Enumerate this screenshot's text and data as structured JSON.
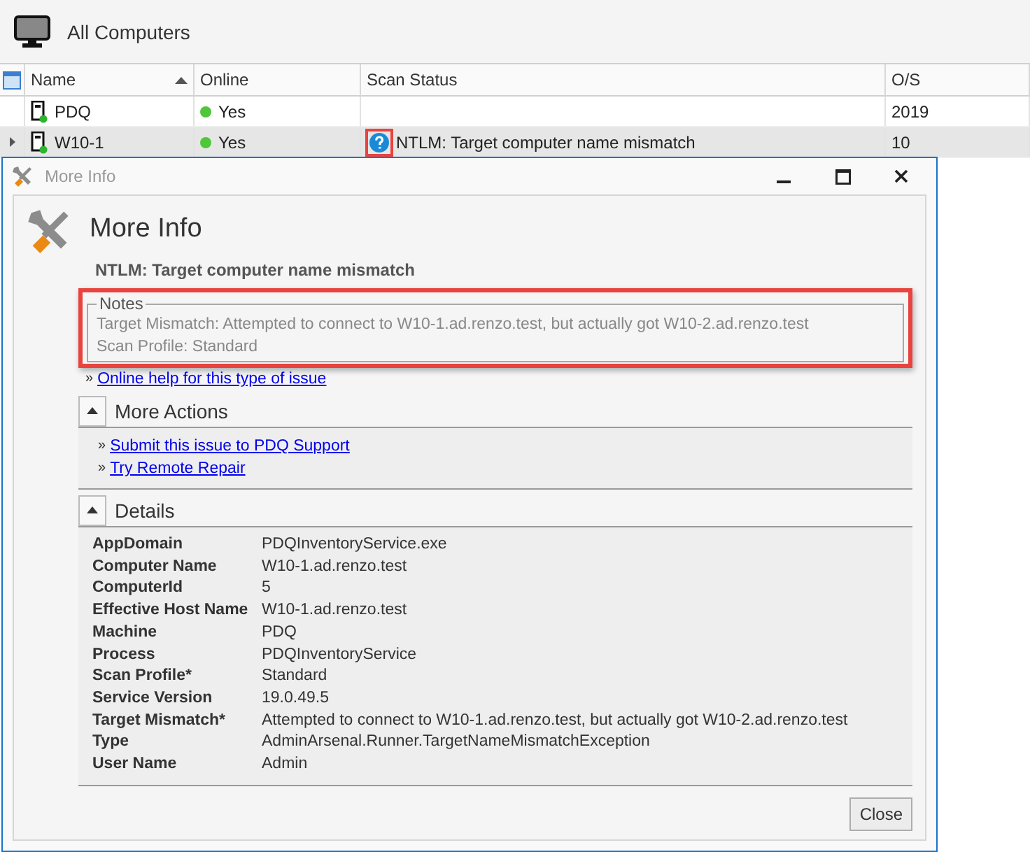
{
  "header": {
    "title": "All Computers"
  },
  "grid": {
    "columns": [
      {
        "label": "Name",
        "sorted": true
      },
      {
        "label": "Online",
        "sorted": false
      },
      {
        "label": "Scan Status",
        "sorted": false
      },
      {
        "label": "O/S",
        "sorted": false
      }
    ],
    "rows": [
      {
        "name": "PDQ",
        "online": "Yes",
        "scan_status": "",
        "os": "2019",
        "selected": false
      },
      {
        "name": "W10-1",
        "online": "Yes",
        "scan_status": "NTLM: Target computer name mismatch",
        "os": "10",
        "selected": true,
        "highlighted": true
      }
    ]
  },
  "dialog": {
    "window_title": "More Info",
    "heading": "More Info",
    "subtitle": "NTLM: Target computer name mismatch",
    "notes": {
      "legend": "Notes",
      "highlighted": true,
      "lines": [
        "Target Mismatch: Attempted to connect to W10-1.ad.renzo.test, but actually got W10-2.ad.renzo.test",
        "Scan Profile: Standard"
      ]
    },
    "help_link": {
      "bullet": "»",
      "label": "Online help for this type of issue"
    },
    "sections": [
      {
        "kind": "links",
        "title": "More Actions",
        "expanded": true,
        "links": [
          {
            "bullet": "»",
            "label": "Submit this issue to PDQ Support"
          },
          {
            "bullet": "»",
            "label": "Try Remote Repair"
          }
        ]
      },
      {
        "kind": "details",
        "title": "Details",
        "expanded": true,
        "rows": [
          {
            "key": "AppDomain",
            "value": "PDQInventoryService.exe"
          },
          {
            "key": "Computer Name",
            "value": "W10-1.ad.renzo.test"
          },
          {
            "key": "ComputerId",
            "value": "5"
          },
          {
            "key": "Effective Host Name",
            "value": "W10-1.ad.renzo.test"
          },
          {
            "key": "Machine",
            "value": "PDQ"
          },
          {
            "key": "Process",
            "value": "PDQInventoryService"
          },
          {
            "key": "Scan Profile*",
            "value": "Standard"
          },
          {
            "key": "Service Version",
            "value": "19.0.49.5"
          },
          {
            "key": "Target Mismatch*",
            "value": "Attempted to connect to W10-1.ad.renzo.test, but actually got W10-2.ad.renzo.test"
          },
          {
            "key": "Type",
            "value": "AdminArsenal.Runner.TargetNameMismatchException"
          },
          {
            "key": "User Name",
            "value": "Admin"
          }
        ]
      }
    ],
    "close_button": "Close"
  }
}
